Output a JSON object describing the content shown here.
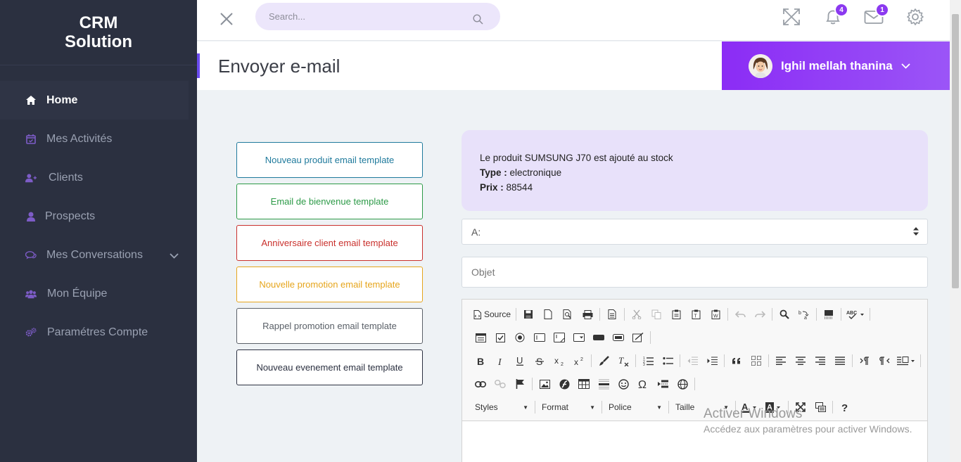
{
  "brand": {
    "line1": "CRM",
    "line2": "Solution"
  },
  "sidebar": {
    "items": [
      {
        "label": "Home",
        "icon": "home-icon",
        "active": true
      },
      {
        "label": "Mes Activités",
        "icon": "calendar-icon"
      },
      {
        "label": "Clients",
        "icon": "user-plus-icon"
      },
      {
        "label": "Prospects",
        "icon": "user-icon"
      },
      {
        "label": "Mes Conversations",
        "icon": "chat-icon",
        "has_children": true
      },
      {
        "label": "Mon Équipe",
        "icon": "users-icon"
      },
      {
        "label": "Paramétres Compte",
        "icon": "cogs-icon"
      }
    ]
  },
  "topbar": {
    "search_placeholder": "Search...",
    "notifications_count": "4",
    "messages_count": "1"
  },
  "page": {
    "title": "Envoyer e-mail",
    "user_name": "Ighil mellah thanina"
  },
  "templates": [
    {
      "label": "Nouveau produit email template",
      "color": "#1f7a9c"
    },
    {
      "label": "Email de bienvenue template",
      "color": "#2c9a47"
    },
    {
      "label": "Anniversaire client email template",
      "color": "#c9302c"
    },
    {
      "label": "Nouvelle promotion email template",
      "color": "#e6a51c"
    },
    {
      "label": "Rappel promotion email template",
      "color": "#5a6068"
    },
    {
      "label": "Nouveau evenement email template",
      "color": "#2b3040"
    }
  ],
  "preview": {
    "line1": "Le produit SUMSUNG J70 est ajouté au stock",
    "type_label": "Type :",
    "type_value": "electronique",
    "price_label": "Prix :",
    "price_value": "88544"
  },
  "form": {
    "to_value": "A:",
    "subject_placeholder": "Objet"
  },
  "editor": {
    "source_label": "Source",
    "styles_label": "Styles",
    "format_label": "Format",
    "font_label": "Police",
    "size_label": "Taille"
  },
  "watermark": {
    "line1": "Activer Windows",
    "line2": "Accédez aux paramètres pour activer Windows."
  },
  "colors": {
    "sidebar_bg": "#2b3040",
    "accent": "#8b2cf5",
    "preview_bg": "#e8e1fa"
  }
}
